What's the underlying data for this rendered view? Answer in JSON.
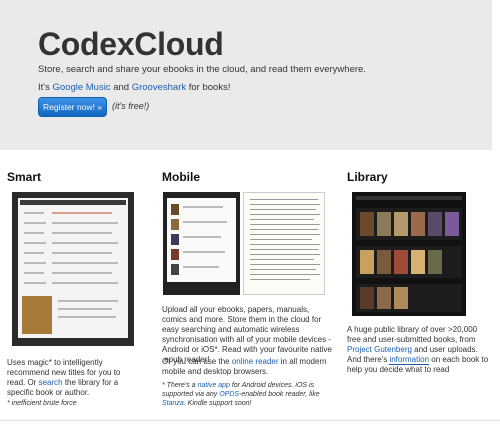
{
  "hero": {
    "title": "CodexCloud",
    "subtitle": "Store, search and share your ebooks in the cloud, and read them everywhere.",
    "tagline_pre": "It's ",
    "tagline_link1": "Google Music",
    "tagline_mid": " and ",
    "tagline_link2": "Grooveshark",
    "tagline_post": " for books!",
    "register_label": "Register now! »",
    "free_label": "(it's free!)"
  },
  "columns": {
    "smart": {
      "heading": "Smart",
      "desc_1": "Uses magic* to intelligently recommend new titles for you to read. Or ",
      "desc_link": "search",
      "desc_2": " the library for a specific book or author.",
      "note": "* inefficient brute force"
    },
    "mobile": {
      "heading": "Mobile",
      "desc_1": "Upload all your ebooks, papers, manuals, comics and more. Store them in the cloud for easy searching and automatic wireless synchronisation with all of your mobile devices - Android or iOS*. Read with your favourite native .epub reader!",
      "desc_2_pre": "Or you can use the ",
      "desc_2_link": "online reader",
      "desc_2_post": " in all modern mobile and desktop browsers.",
      "note_pre": "* There's a ",
      "note_link1": "native app",
      "note_mid1": " for Android devices. iOS is supported via any ",
      "note_link2": "OPDS",
      "note_mid2": "-enabled book reader, like ",
      "note_link3": "Stanza",
      "note_post": ". Kindle support soon!"
    },
    "library": {
      "heading": "Library",
      "desc_1": "A huge public library of over >20,000 free and user-submitted books, from ",
      "desc_link1": "Project Gutenberg",
      "desc_2": " and user uploads. And there's ",
      "desc_link2": "information",
      "desc_3": " on each book to help you decide what to read"
    }
  },
  "colors": {
    "hero_bg": "#eaeaea",
    "link": "#1a5fb4",
    "button": "#1877d6"
  }
}
